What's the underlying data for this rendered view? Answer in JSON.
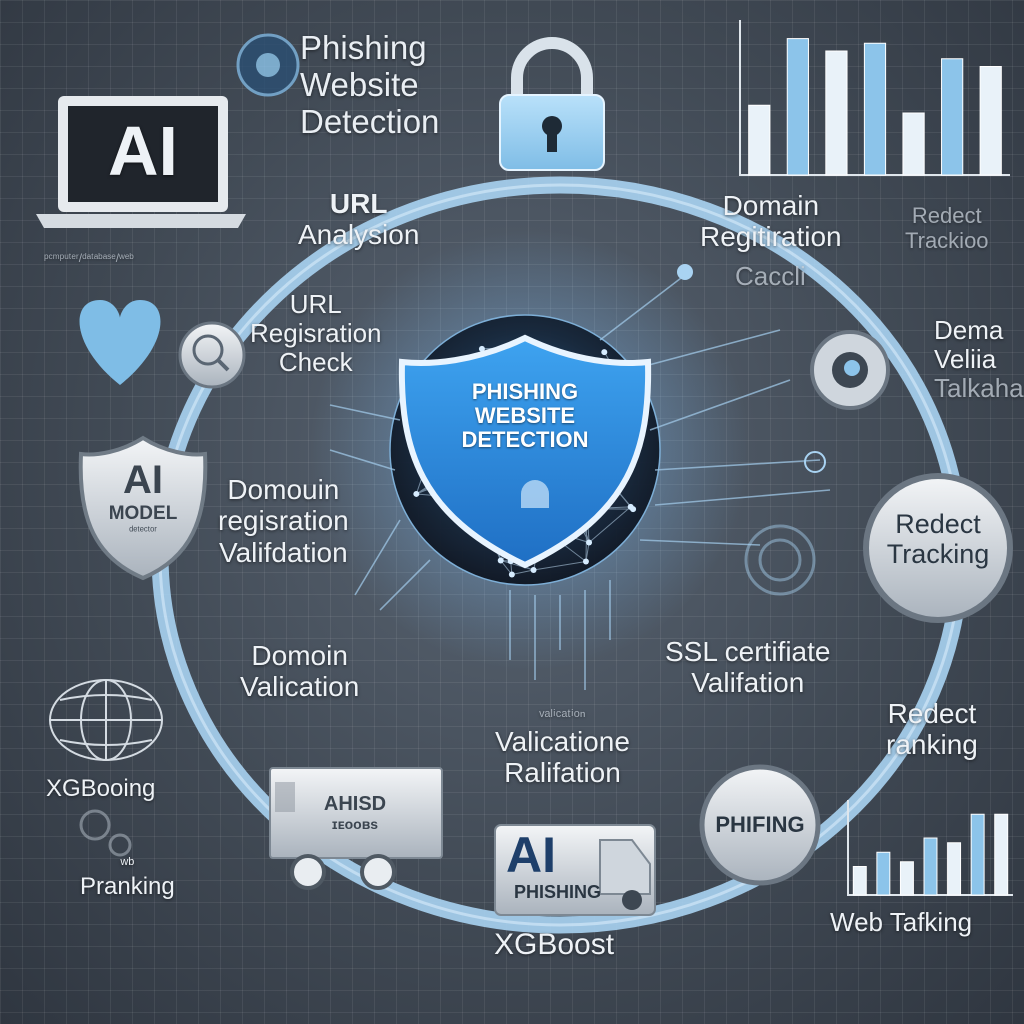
{
  "title": {
    "lines": [
      "Phishing",
      "Website",
      "Detection"
    ]
  },
  "shield": {
    "lines": [
      "PHISHING",
      "WEBSITE",
      "DETECTION"
    ]
  },
  "laptop": {
    "text": "AI"
  },
  "laptop_caption": "ᵖᶜᵐᵖᵘᵗᵉʳ/ᵈᵃᵗᵃᵇᵃˢᵉ/ʷᵉᵇ",
  "ai_model_badge": {
    "lines": [
      "AI",
      "MODEL"
    ],
    "sub": "ᵈᵉᵗᵉᶜᵗᵒʳ"
  },
  "truck": {
    "lines": [
      "AHISD",
      "ɪᴇᴏᴏʙs"
    ]
  },
  "ai_phishing_badge": {
    "lines": [
      "AI",
      "PHISHING"
    ]
  },
  "phifing_button": {
    "text": "PHIFING"
  },
  "redect_button": {
    "lines": [
      "Redect",
      "Tracking"
    ]
  },
  "labels": {
    "url_analysis": [
      "URL",
      "Analysion"
    ],
    "url_registration": [
      "URL",
      "Regisration",
      "Check"
    ],
    "domoin_registration": [
      "Domouin",
      "regisration",
      "Valifdation"
    ],
    "domoin_valication": [
      "Domoin",
      "Valication"
    ],
    "xgbooing": "XGBooing",
    "pranking": [
      "ʷᵇ",
      "Pranking"
    ],
    "valicatione": [
      "ᵛᵃˡⁱᶜᵃᵗⁱᵒⁿ",
      "Valicatione",
      "Ralifation"
    ],
    "xgboost": "XGBoost",
    "ssl": [
      "SSL certifiate",
      "Valifation"
    ],
    "domain_regitiration": [
      "Domain",
      "Regitiration"
    ],
    "cacci": "Caccli",
    "redect_tracking_top": [
      "Redect",
      "Trackioo"
    ],
    "dema": [
      "Dema",
      "Veliia",
      "Talkaha"
    ],
    "redect_ranking": [
      "Redect",
      "ranking"
    ],
    "web_tafking": "Web Tafking"
  },
  "chart_data": [
    {
      "type": "bar",
      "title": "",
      "values": [
        0.45,
        0.88,
        0.8,
        0.85,
        0.4,
        0.75,
        0.7
      ]
    },
    {
      "type": "bar",
      "title": "",
      "values": [
        0.3,
        0.45,
        0.35,
        0.6,
        0.55,
        0.85,
        0.85
      ]
    }
  ],
  "colors": {
    "accent": "#8cc4ea",
    "shield": "#2f8fe0",
    "ring": "#a9d3f2",
    "text": "#eef2f6"
  }
}
